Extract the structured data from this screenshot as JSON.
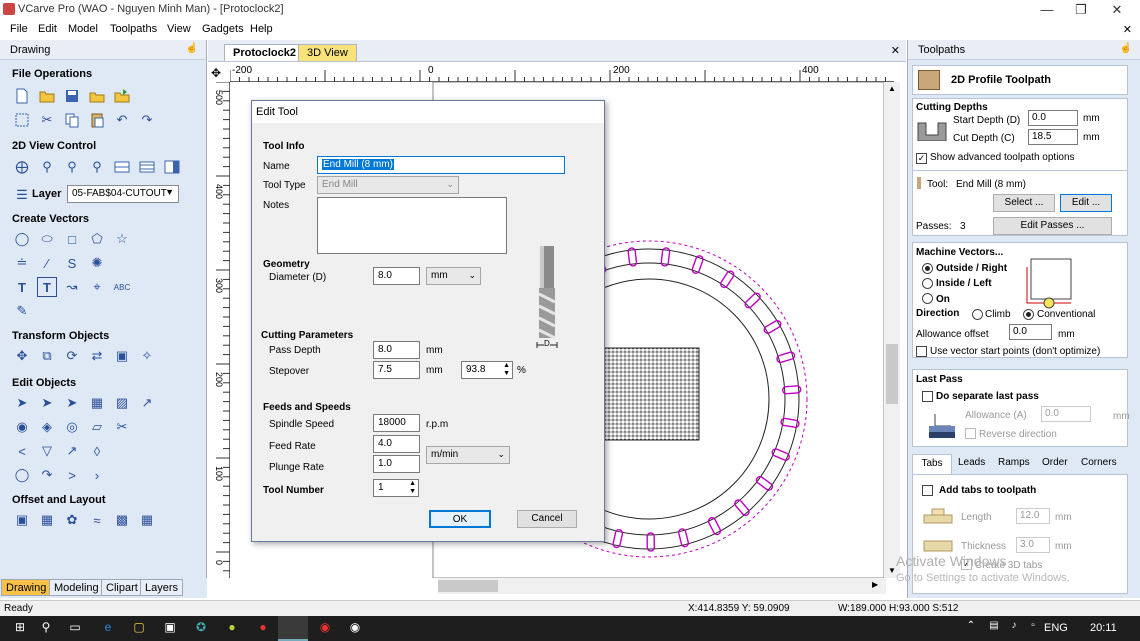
{
  "window": {
    "title": "VCarve Pro (WAO - Nguyen Minh Man) - [Protoclock2]"
  },
  "menu": [
    "File",
    "Edit",
    "Model",
    "Toolpaths",
    "View",
    "Gadgets",
    "Help"
  ],
  "left_panel": {
    "header": "Drawing",
    "sections": {
      "file_ops": "File Operations",
      "view_2d": "2D View Control",
      "create_vectors": "Create Vectors",
      "transform": "Transform Objects",
      "edit_objects": "Edit Objects",
      "offset_layout": "Offset and Layout"
    },
    "layer_label": "Layer",
    "layer_value": "05-FAB$04-CUTOUT",
    "tabs": [
      "Drawing",
      "Modeling",
      "Clipart",
      "Layers"
    ]
  },
  "doc_tabs": [
    "Protoclock2",
    "3D View"
  ],
  "ruler_top": [
    "-200",
    "0",
    "200",
    "400"
  ],
  "ruler_left": [
    "500",
    "400",
    "300",
    "200",
    "100",
    "0"
  ],
  "dialog": {
    "title": "Edit Tool",
    "tool_info": "Tool Info",
    "name_label": "Name",
    "name_value": "End Mill (8 mm)",
    "tool_type_label": "Tool Type",
    "tool_type_value": "End Mill",
    "notes_label": "Notes",
    "geometry": "Geometry",
    "diameter_label": "Diameter (D)",
    "diameter_value": "8.0",
    "diameter_unit": "mm",
    "cutting_params": "Cutting Parameters",
    "pass_depth_label": "Pass Depth",
    "pass_depth_value": "8.0",
    "pass_depth_unit": "mm",
    "stepover_label": "Stepover",
    "stepover_value": "7.5",
    "stepover_unit": "mm",
    "stepover_pct": "93.8",
    "pct_sign": "%",
    "feeds": "Feeds and Speeds",
    "spindle_label": "Spindle Speed",
    "spindle_value": "18000",
    "spindle_unit": "r.p.m",
    "feed_label": "Feed Rate",
    "feed_value": "4.0",
    "plunge_label": "Plunge Rate",
    "plunge_value": "1.0",
    "rate_unit": "m/min",
    "tool_number_label": "Tool Number",
    "tool_number_value": "1",
    "ok": "OK",
    "cancel": "Cancel",
    "d_label": "D"
  },
  "right_panel": {
    "header": "Toolpaths",
    "toolpath_title": "2D Profile Toolpath",
    "cutting_depths": "Cutting Depths",
    "start_depth_label": "Start Depth (D)",
    "start_depth_value": "0.0",
    "cut_depth_label": "Cut Depth (C)",
    "cut_depth_value": "18.5",
    "mm": "mm",
    "show_advanced": "Show advanced toolpath options",
    "tool_label": "Tool:",
    "tool_value": "End Mill (8 mm)",
    "select_btn": "Select ...",
    "edit_btn": "Edit ...",
    "passes_label": "Passes:",
    "passes_value": "3",
    "edit_passes_btn": "Edit Passes ...",
    "machine_vectors": "Machine Vectors...",
    "outside_right": "Outside / Right",
    "inside_left": "Inside / Left",
    "on": "On",
    "direction": "Direction",
    "climb": "Climb",
    "conventional": "Conventional",
    "allowance_label": "Allowance offset",
    "allowance_value": "0.0",
    "vector_start": "Use vector start points (don't optimize)",
    "last_pass": "Last Pass",
    "do_separate": "Do separate last pass",
    "allowance_a_label": "Allowance (A)",
    "allowance_a_value": "0.0",
    "reverse_dir": "Reverse direction",
    "tabs": [
      "Tabs",
      "Leads",
      "Ramps",
      "Order",
      "Corners"
    ],
    "add_tabs": "Add tabs to toolpath",
    "length_label": "Length",
    "length_value": "12.0",
    "thickness_label": "Thickness",
    "thickness_value": "3.0",
    "create_3d_tabs": "Create 3D tabs"
  },
  "status": {
    "ready": "Ready",
    "coords": "X:414.8359 Y: 59.0909",
    "dims": "W:189.000  H:93.000  S:512"
  },
  "watermark": {
    "line1": "Activate Windows",
    "line2": "Go to Settings to activate Windows."
  },
  "taskbar": {
    "lang": "ENG",
    "time": "20:11"
  },
  "colors": {
    "accent": "#0078d7",
    "toolpath_magenta": "#c000c0",
    "panel_bg": "#dfe9f5"
  }
}
